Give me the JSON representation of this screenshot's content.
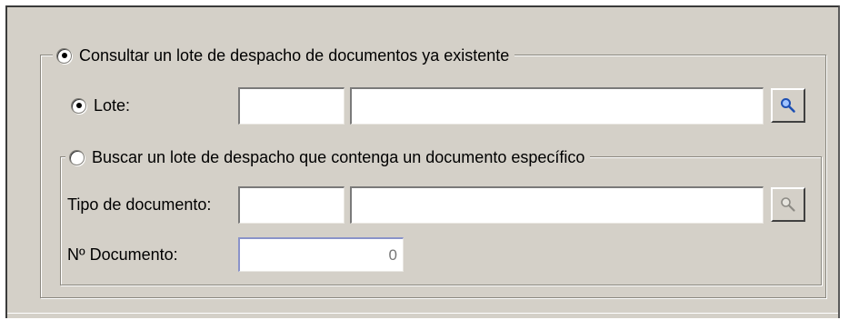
{
  "outer_group": {
    "legend": "Consultar un lote de despacho de documentos ya existente",
    "selected": true
  },
  "lote": {
    "label": "Lote:",
    "selected": true,
    "code_value": "",
    "description_value": "",
    "search_icon": "magnifier-icon",
    "search_enabled": true
  },
  "inner_group": {
    "legend": "Buscar un lote de despacho que contenga un documento específico",
    "selected": false
  },
  "tipo_documento": {
    "label": "Tipo de documento:",
    "code_value": "",
    "description_value": "",
    "search_icon": "magnifier-icon",
    "search_enabled": false
  },
  "numero_documento": {
    "label": "Nº Documento:",
    "value": "0"
  },
  "colors": {
    "dialog_bg": "#d4d0c8",
    "icon_blue": "#1d4fb3"
  }
}
